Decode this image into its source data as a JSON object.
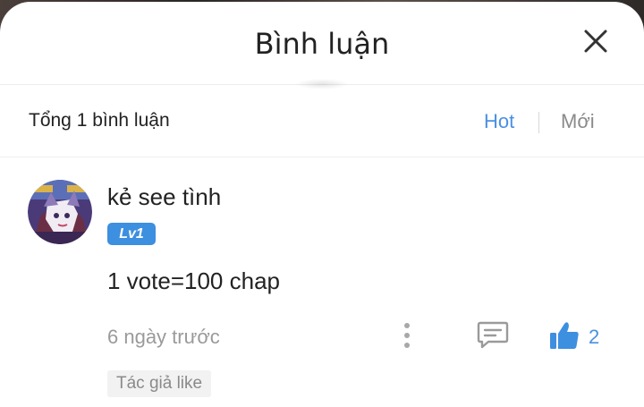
{
  "header": {
    "title": "Bình luận"
  },
  "subheader": {
    "total": "Tổng 1 bình luận",
    "sort_hot": "Hot",
    "sort_new": "Mới"
  },
  "comment": {
    "username": "kẻ see tình",
    "level": "Lv1",
    "text": "1 vote=100 chap",
    "time": "6 ngày trước",
    "likes": "2",
    "author_tag": "Tác giả like"
  },
  "colors": {
    "accent": "#4a90e2",
    "level_badge": "#3d8fe0",
    "muted_text": "#9a9a9a"
  },
  "icons": [
    "close-icon",
    "more-icon",
    "reply-icon",
    "like-icon"
  ]
}
